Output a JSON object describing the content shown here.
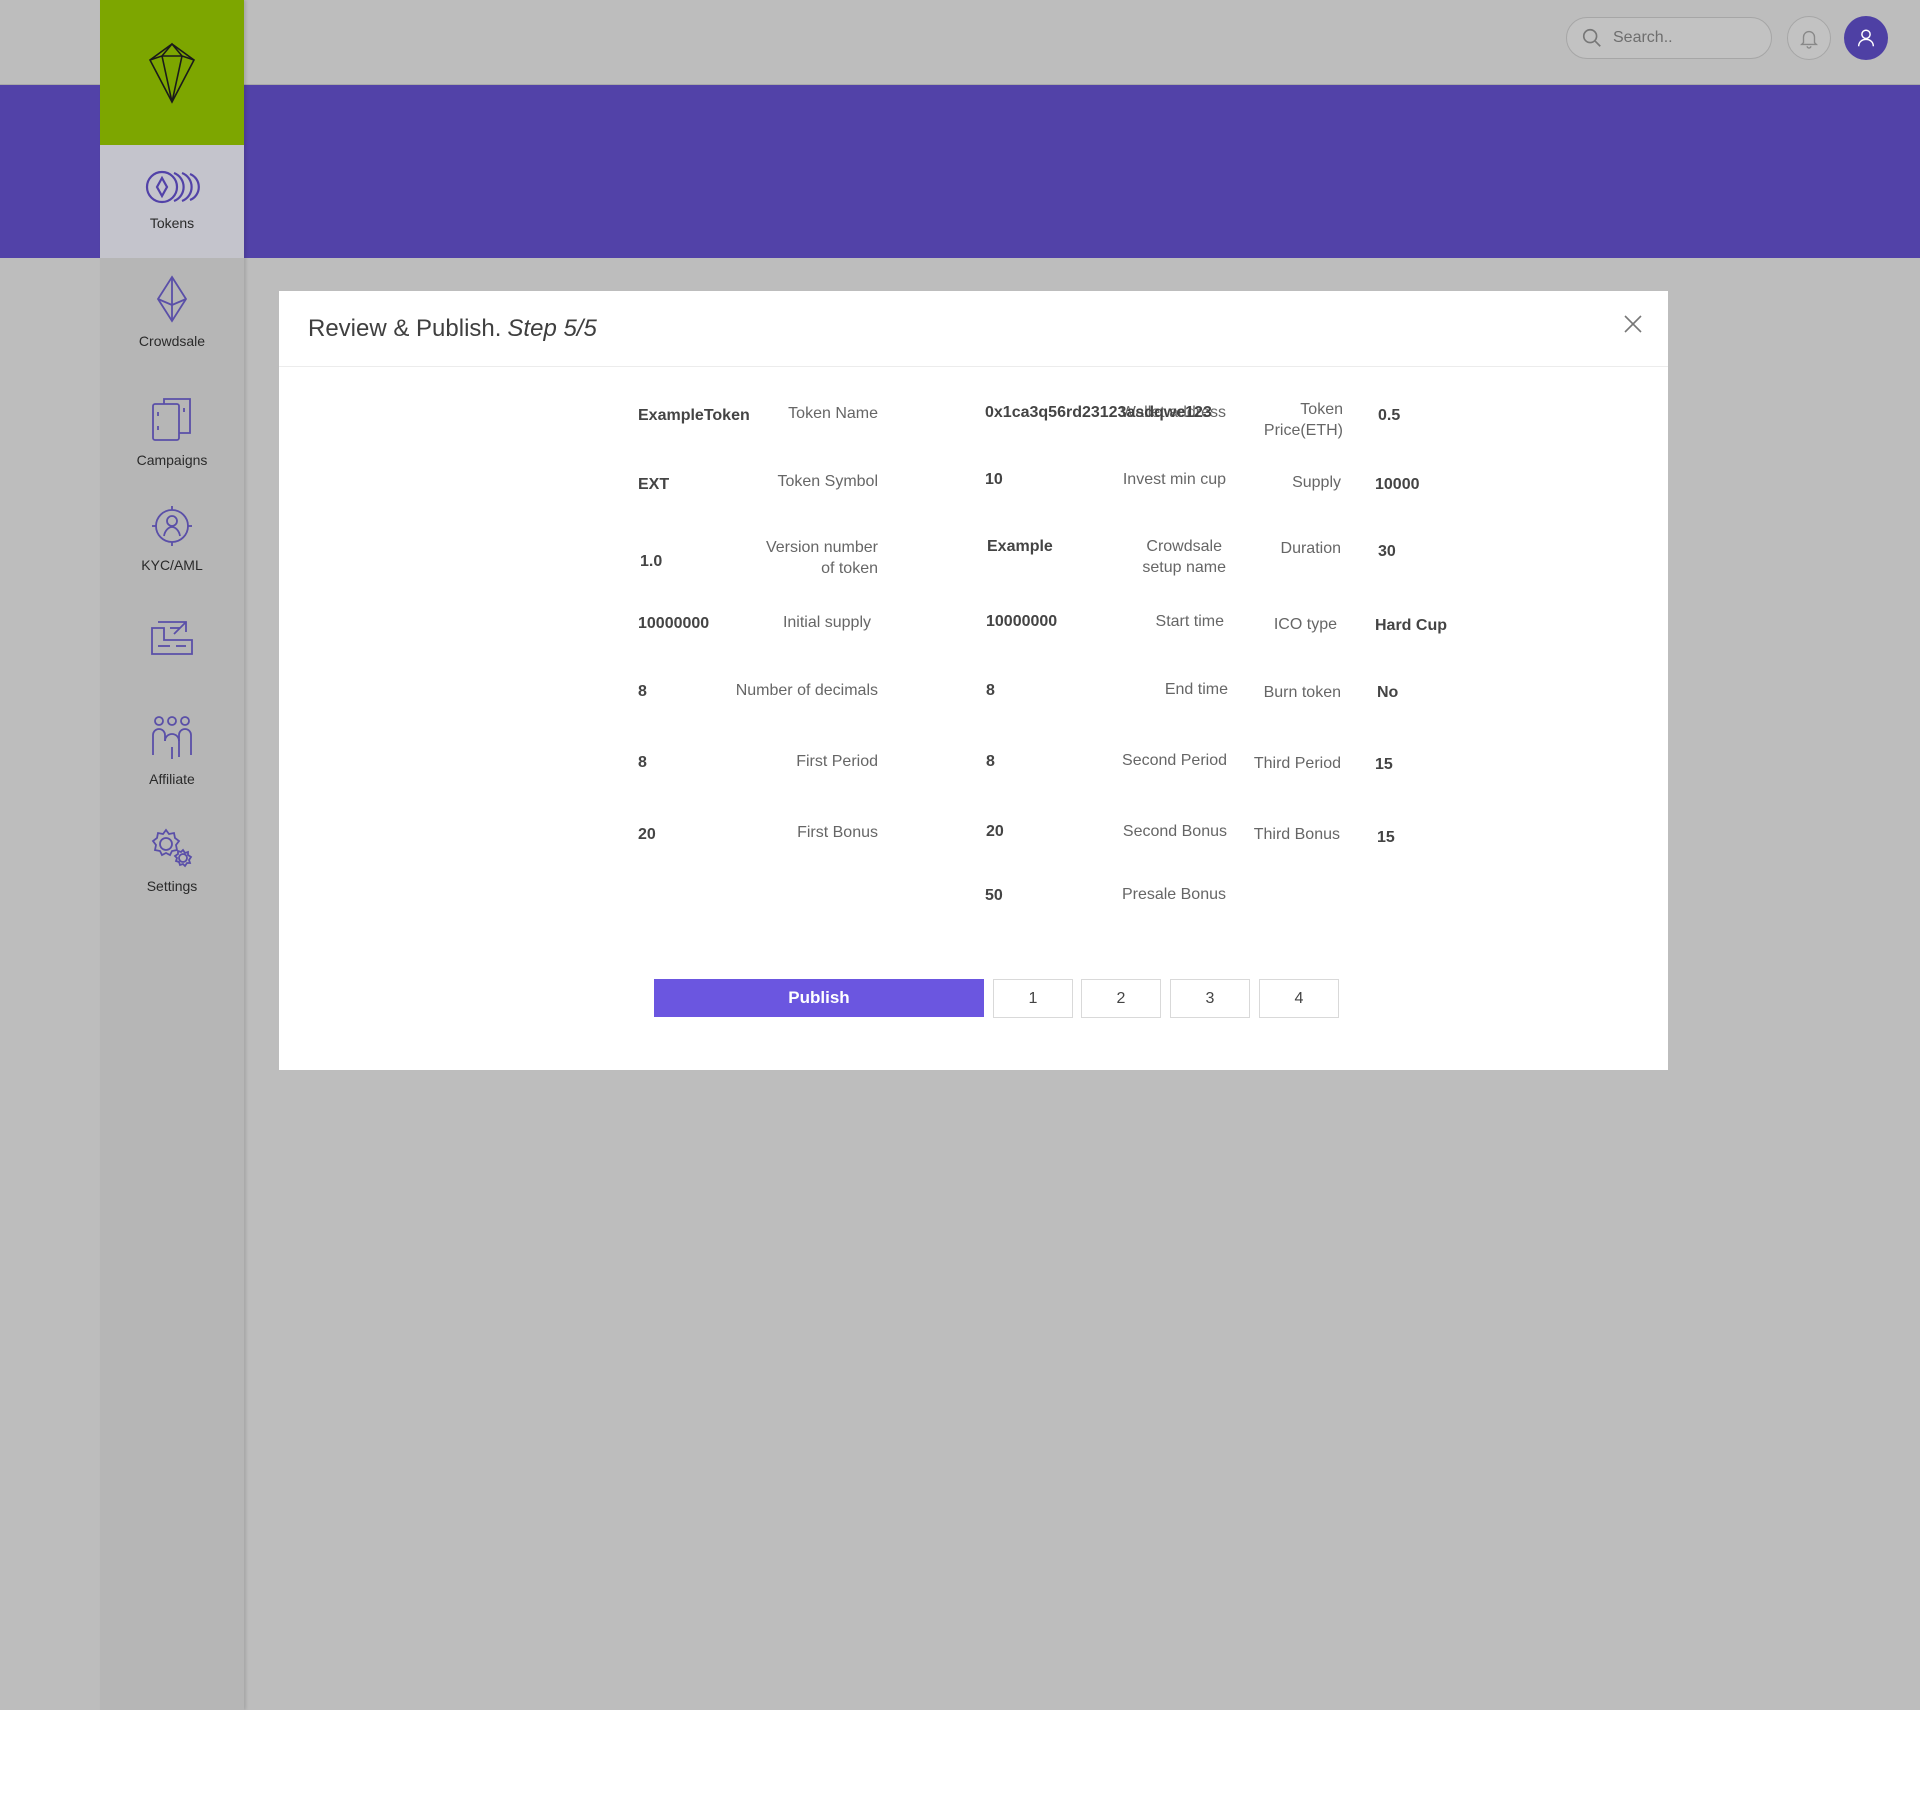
{
  "topbar": {
    "search_placeholder": "Search.."
  },
  "sidebar": {
    "items": [
      {
        "label": "Tokens",
        "icon": "tokens-icon"
      },
      {
        "label": "Crowdsale",
        "icon": "ethereum-icon"
      },
      {
        "label": "Campaigns",
        "icon": "campaigns-icon"
      },
      {
        "label": "KYC/AML",
        "icon": "kyc-icon"
      },
      {
        "label": "",
        "icon": "contract-icon"
      },
      {
        "label": "Affiliate",
        "icon": "affiliate-icon"
      },
      {
        "label": "Settings",
        "icon": "settings-icon"
      }
    ]
  },
  "modal": {
    "title": "Review & Publish.",
    "step": "Step 5/5",
    "fields": {
      "token_name": {
        "label": "Token Name",
        "value": "ExampleToken"
      },
      "token_symbol": {
        "label": "Token Symbol",
        "value": "EXT"
      },
      "version": {
        "label_line1": "Version number",
        "label_line2": "of token",
        "value": "1.0"
      },
      "initial_supply": {
        "label": "Initial supply",
        "value": "10000000"
      },
      "decimals": {
        "label": "Number of decimals",
        "value": "8"
      },
      "first_period": {
        "label": "First Period",
        "value": "8"
      },
      "first_bonus": {
        "label": "First Bonus",
        "value": "20"
      },
      "wallet": {
        "label": "Wallet address",
        "value": "0x1ca3q56rd23123asdqwe123"
      },
      "invest_min": {
        "label": "Invest min cup",
        "value": "10"
      },
      "crowdsale_name": {
        "label_line1": "Crowdsale",
        "label_line2": "setup name",
        "value": "Example"
      },
      "start_time": {
        "label": "Start time",
        "value": "10000000"
      },
      "end_time": {
        "label": "End time",
        "value": "8"
      },
      "second_period": {
        "label": "Second Period",
        "value": "8"
      },
      "second_bonus": {
        "label": "Second Bonus",
        "value": "20"
      },
      "presale_bonus": {
        "label": "Presale Bonus",
        "value": "50"
      },
      "token_price": {
        "label_line1": "Token",
        "label_line2": "Price(ETH)",
        "value": "0.5"
      },
      "supply": {
        "label": "Supply",
        "value": "10000"
      },
      "duration": {
        "label": "Duration",
        "value": "30"
      },
      "ico_type": {
        "label": "ICO type",
        "value": "Hard Cup"
      },
      "burn_token": {
        "label": "Burn token",
        "value": "No"
      },
      "third_period": {
        "label": "Third Period",
        "value": "15"
      },
      "third_bonus": {
        "label": "Third Bonus",
        "value": "15"
      }
    },
    "publish_label": "Publish",
    "steps": [
      "1",
      "2",
      "3",
      "4"
    ]
  },
  "colors": {
    "banner": "#5242a8",
    "logo_bg": "#7da600",
    "accent": "#6b56e0",
    "backdrop": "#bdbdbd"
  }
}
